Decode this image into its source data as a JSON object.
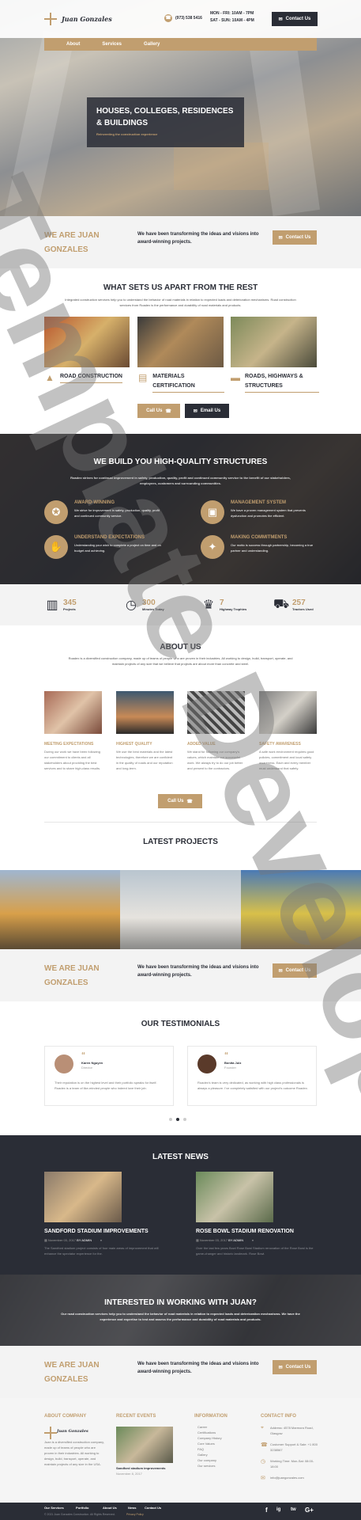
{
  "header": {
    "logo_text": "Juan Gonzales",
    "phone": "(973) 538 5416",
    "hours_weekday": "MON - FRI: 10AM - 7PM",
    "hours_weekend": "SAT - SUN: 10AM - 4PM",
    "contact_btn": "Contact Us",
    "nav": [
      "About",
      "Services",
      "Gallery"
    ]
  },
  "hero": {
    "title": "Houses, Colleges, Residences & Buildings",
    "subtitle": "Reinventing the construction experience"
  },
  "cta": {
    "left": "We are Juan Gonzales",
    "text": "We have been transforming the ideas and visions into award-winning projects.",
    "button": "Contact Us"
  },
  "apart": {
    "title": "What sets us apart from the rest",
    "desc": "Integrated construction services help you to understand the behavior of road materials in relation to expected loads and deterioration mechanisms. Road construction services from Roadex is the performance and durability of road materials and products.",
    "features": [
      "Road Construction",
      "Materials Certification",
      "Roads, Highways & Structures"
    ],
    "call_btn": "Call Us",
    "email_btn": "Email Us"
  },
  "quality": {
    "title": "We build you high-quality structures",
    "desc": "Roadex strives for continual improvement in safety, production, quality, profit and continued community service to the benefit of our stakeholders, employees, customers and surrounding communities.",
    "items": [
      {
        "title": "Award-Winning",
        "text": "We strive for improvement in safety, production, quality, profit and continued community service."
      },
      {
        "title": "Management System",
        "text": "We have a proven management system that prevents dysfunction and promotes the efficient."
      },
      {
        "title": "Understand Expectations",
        "text": "Understanding your wish to complete a project on time and on budget and achieving."
      },
      {
        "title": "Making Commitments",
        "text": "Our motto is success through partnership, becoming a true partner and understanding."
      }
    ]
  },
  "stats": [
    {
      "num": "345",
      "label": "Projects"
    },
    {
      "num": "300",
      "label": "Minutes Today"
    },
    {
      "num": "7",
      "label": "Highway Trophies"
    },
    {
      "num": "257",
      "label": "Tractors Used"
    }
  ],
  "about": {
    "title": "About Us",
    "desc": "Roadex is a diversified construction company, made up of teams of people who are proven in their industries. All working to design, build, transport, operate, and maintain projects of any size that we believe that projects are about more than concrete and steel.",
    "cards": [
      {
        "title": "Meeting Expectations",
        "text": "During our work we have been following our commitment to clients and all stakeholders about providing the best services and to share high-class results."
      },
      {
        "title": "Highest Quality",
        "text": "We use the best materials and the latest technologies, therefore we are confident in the quality of roads and our reputation and long-term."
      },
      {
        "title": "Added Value",
        "text": "We stand for following our company's values, which maintain our successful work. We always try to do our job better and present to the contractors."
      },
      {
        "title": "Safety Awareness",
        "text": "A safe work environment requires good policies, commitment and local safety awareness. Each and every member must understand that safety."
      }
    ],
    "call_btn": "Call Us"
  },
  "projects": {
    "title": "Latest Projects"
  },
  "cta2": {
    "left": "We are Juan Gonzales",
    "text": "We have been transforming the ideas and visions into award-winning projects.",
    "button": "Contact Us"
  },
  "testimonials": {
    "title": "Our Testimonials",
    "items": [
      {
        "name": "Karen Nguyen",
        "role": "Director",
        "text": "Their reputation is on the highest level and their portfolio speaks for itself. Roadex is a team of like-minded people who indeed love their job."
      },
      {
        "name": "Bonita Julz",
        "role": "Founder",
        "text": "Roadex's team is very dedicated, as working with high class professionals is always a pleasure. I've completely satisfied with our project's outcome Roadex."
      }
    ]
  },
  "news": {
    "title": "Latest News",
    "items": [
      {
        "title": "Sandford Stadium Improvements",
        "date": "November 03, 2017",
        "author": "BY ADMIN",
        "text": "The Sandford stadium project consists of four main areas of improvement that will enhance the spectator experience for the."
      },
      {
        "title": "Rose Bowl Stadium Renovation",
        "date": "November 03, 2017",
        "author": "BY ADMIN",
        "text": "Over the last few years Bowl Rose Bowl Stadium renovation of the Rose Bowl is the game-changer and historic landmark. Rose Bowl."
      }
    ]
  },
  "interest": {
    "title": "Interested in working with Juan?",
    "desc": "Our road construction services help you to understand the behavior of road materials in relation to expected loads and deterioration mechanisms. We have the experience and expertise to test and assess the performance and durability of road materials and products."
  },
  "cta3": {
    "left": "We are Juan Gonzales",
    "text": "We have been transforming the ideas and visions into award-winning projects.",
    "button": "Contact Us"
  },
  "footer": {
    "about_title": "About Company",
    "about_logo": "Juan Gonzales",
    "about_text": "Juan is a diversified construction company, made up of teams of people who are proven in their industries. All working to design, build, transport, operate, and maintain projects of any size in the USA.",
    "events_title": "Recent Events",
    "event_name": "Sandford stadium improvements",
    "event_date": "November 8, 2017",
    "info_title": "Information",
    "info_links": [
      "Career",
      "Certifications",
      "Company History",
      "Core Values",
      "FAQ",
      "Gallery",
      "Our company",
      "Our services"
    ],
    "contact_title": "Contact Info",
    "address": "Address: 4578 Marmora Road, Glasgow",
    "support": "Customer Support & Sale: +1 800 3238567",
    "hours": "Working Time: Mon-Sat: 08:00-18:00",
    "email": "info@juangonzales.com"
  },
  "bottom": {
    "links": [
      "Our Services",
      "Portfolio",
      "About Us",
      "News",
      "Contact Us"
    ],
    "copy": "© 2021 Juan Gonzales Construction. All Rights Reserved.",
    "policy": "Privacy Policy",
    "social": [
      "f",
      "ig",
      "tw",
      "G+"
    ]
  },
  "watermark": "Template Developer",
  "colors": {
    "gold": "#c19e6f",
    "dark": "#2a2d36",
    "light": "#f3f3f3"
  }
}
